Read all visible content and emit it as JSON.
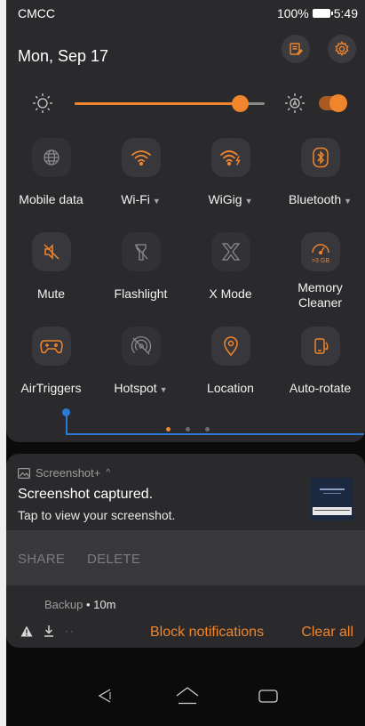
{
  "status_bar": {
    "carrier": "CMCC",
    "battery": "100%",
    "time": "5:49"
  },
  "header": {
    "date": "Mon, Sep 17"
  },
  "brightness": {
    "level": 0.87
  },
  "tiles": [
    {
      "label": "Mobile data",
      "icon": "globe-icon",
      "active": false,
      "dropdown": false
    },
    {
      "label": "Wi-Fi",
      "icon": "wifi-icon",
      "active": true,
      "dropdown": true
    },
    {
      "label": "WiGig",
      "icon": "wigig-icon",
      "active": true,
      "dropdown": true
    },
    {
      "label": "Bluetooth",
      "icon": "bluetooth-icon",
      "active": true,
      "dropdown": true
    },
    {
      "label": "Mute",
      "icon": "mute-icon",
      "active": true,
      "dropdown": false
    },
    {
      "label": "Flashlight",
      "icon": "flashlight-icon",
      "active": false,
      "dropdown": false
    },
    {
      "label": "X Mode",
      "icon": "x-mode-icon",
      "active": false,
      "dropdown": false
    },
    {
      "label": "Memory\nCleaner",
      "icon": "memory-cleaner-icon",
      "active": true,
      "dropdown": false,
      "badge": ">3 GB"
    },
    {
      "label": "AirTriggers",
      "icon": "air-triggers-icon",
      "active": true,
      "dropdown": false
    },
    {
      "label": "Hotspot",
      "icon": "hotspot-icon",
      "active": false,
      "dropdown": true
    },
    {
      "label": "Location",
      "icon": "location-icon",
      "active": true,
      "dropdown": false
    },
    {
      "label": "Auto-rotate",
      "icon": "auto-rotate-icon",
      "active": true,
      "dropdown": false
    }
  ],
  "notification": {
    "app": "Screenshot+",
    "title": "Screenshot captured.",
    "text": "Tap to view your screenshot.",
    "actions": {
      "share": "SHARE",
      "delete": "DELETE"
    }
  },
  "notification2": {
    "app": "Backup",
    "age": "10m",
    "block": "Block notifications",
    "clear": "Clear all"
  },
  "colors": {
    "accent": "#f0852c",
    "panel": "#2a2a2d",
    "highlight": "#2a7bd6"
  }
}
